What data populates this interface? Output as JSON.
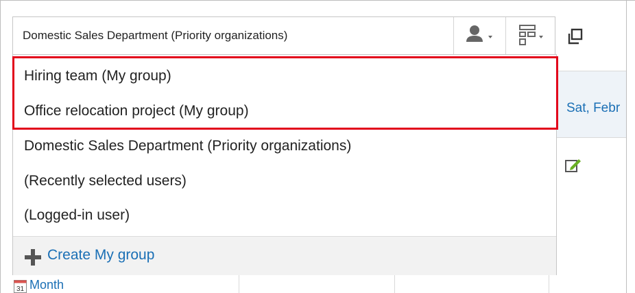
{
  "group_select": {
    "selected_label": "Domestic Sales Department (Priority organizations)",
    "user_button_icon": "person-dropdown-icon",
    "org_button_icon": "org-chart-dropdown-icon"
  },
  "dropdown": {
    "items": [
      {
        "label": "Hiring team (My group)",
        "highlighted": true
      },
      {
        "label": "Office relocation project (My group)",
        "highlighted": true
      },
      {
        "label": "Domestic Sales Department (Priority organizations)",
        "highlighted": false
      },
      {
        "label": "(Recently selected users)",
        "highlighted": false
      },
      {
        "label": "(Logged-in user)",
        "highlighted": false
      }
    ],
    "footer_action": {
      "label": "Create My group",
      "icon": "plus-icon"
    },
    "highlight_color": "#e2001a"
  },
  "calendar": {
    "date_header": "Sat, Febr",
    "month_link": "Month",
    "calendar_icon_day": "31",
    "edit_icon": "edit-icon",
    "popup_icon": "new-window-icon"
  },
  "colors": {
    "link": "#1a6fb5",
    "highlight_border": "#e2001a",
    "footer_bg": "#f2f2f2"
  }
}
